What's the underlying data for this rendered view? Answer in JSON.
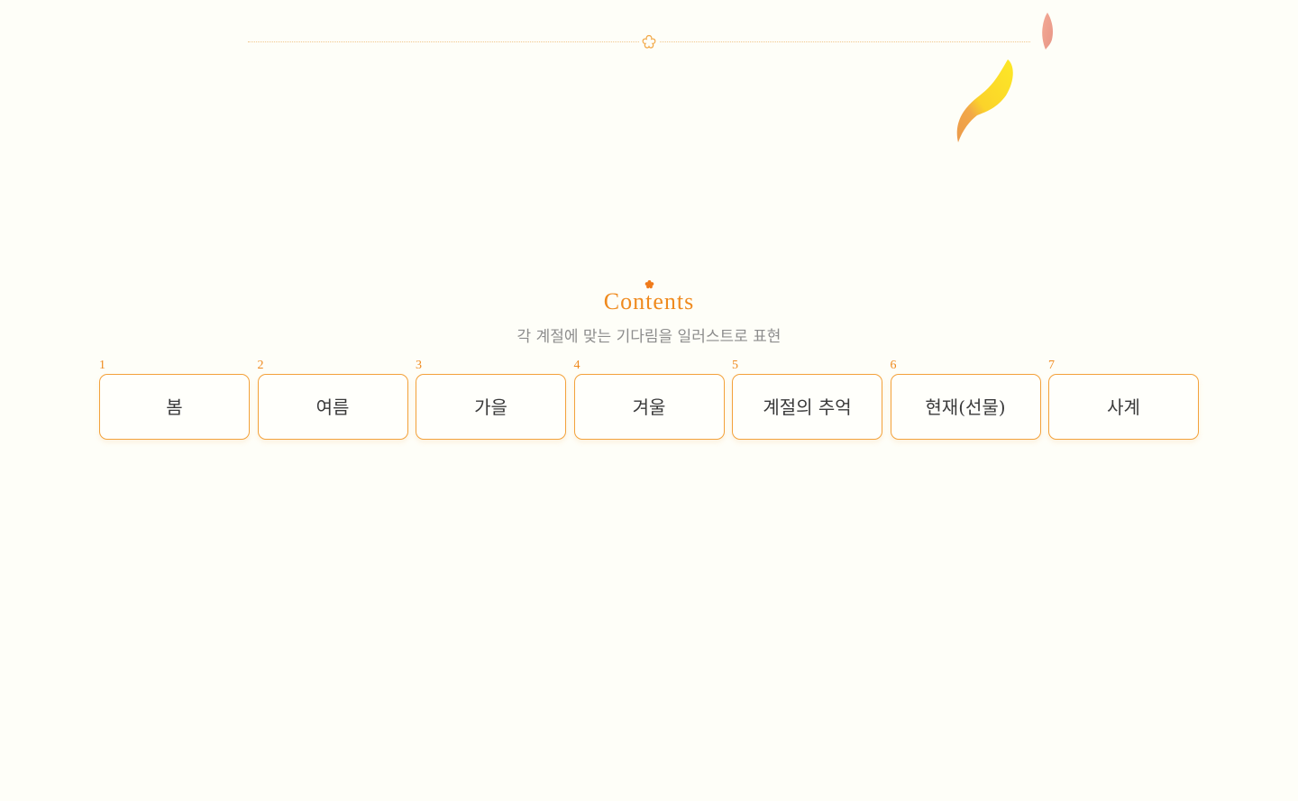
{
  "decor": {
    "divider_icon": "flower-outline-icon",
    "petal_icon": "pink-petal-icon",
    "leaf_icon": "yellow-leaf-icon",
    "accent_color": "#ef8a1e"
  },
  "contents": {
    "icon": "flower-dot-icon",
    "title": "Contents",
    "subtitle": "각 계절에 맞는 기다림을 일러스트로 표현"
  },
  "tabs": [
    {
      "number": "1",
      "label": "봄"
    },
    {
      "number": "2",
      "label": "여름"
    },
    {
      "number": "3",
      "label": "가을"
    },
    {
      "number": "4",
      "label": "겨울"
    },
    {
      "number": "5",
      "label": "계절의 추억"
    },
    {
      "number": "6",
      "label": "현재(선물)"
    },
    {
      "number": "7",
      "label": "사계"
    }
  ]
}
